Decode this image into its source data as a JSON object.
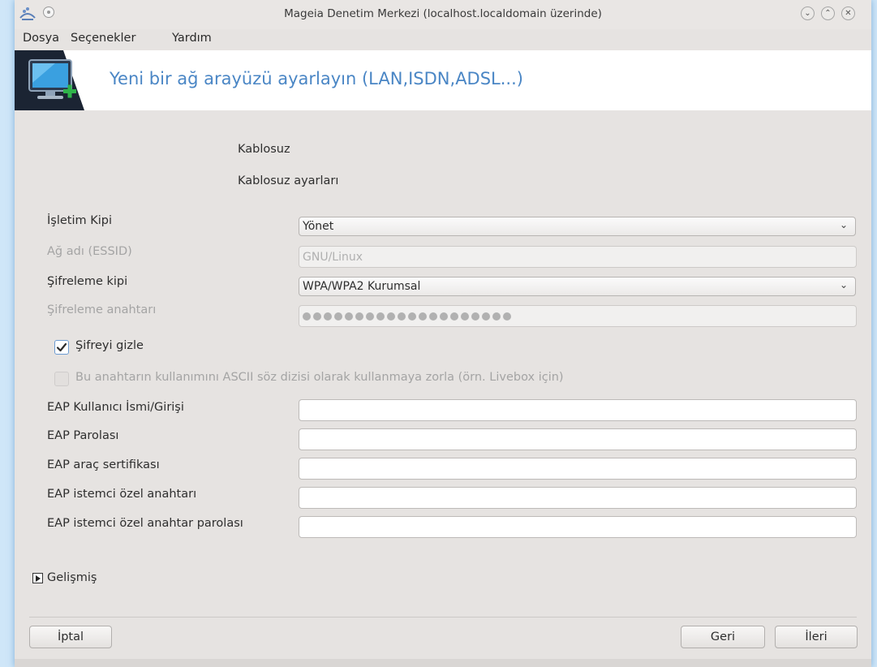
{
  "window": {
    "title": "Mageia Denetim Merkezi  (localhost.localdomain üzerinde)"
  },
  "menubar": {
    "items": [
      "Dosya",
      "Seçenekler",
      "Yardım"
    ]
  },
  "banner": {
    "title": "Yeni bir ağ arayüzü ayarlayın (LAN,ISDN,ADSL...)",
    "icon": "network-monitor-add-icon"
  },
  "sections": {
    "heading1": "Kablosuz",
    "heading2": "Kablosuz ayarları"
  },
  "form": {
    "operation_mode": {
      "label": "İşletim Kipi",
      "value": "Yönet"
    },
    "essid": {
      "label": "Ağ adı (ESSID)",
      "value": "GNU/Linux"
    },
    "encryption_mode": {
      "label": "Şifreleme kipi",
      "value": "WPA/WPA2 Kurumsal"
    },
    "encryption_key": {
      "label": "Şifreleme anahtarı",
      "masked_length": 20
    },
    "hide_password": {
      "label": "Şifreyi gizle",
      "checked": true
    },
    "force_ascii": {
      "label": "Bu anahtarın kullanımını ASCII söz dizisi olarak kullanmaya zorla (örn. Livebox için)",
      "checked": false
    },
    "eap_fields": [
      {
        "label": "EAP Kullanıcı İsmi/Girişi",
        "value": ""
      },
      {
        "label": "EAP Parolası",
        "value": ""
      },
      {
        "label": "EAP araç sertifikası",
        "value": ""
      },
      {
        "label": "EAP istemci özel anahtarı",
        "value": ""
      },
      {
        "label": "EAP istemci özel anahtar parolası",
        "value": ""
      }
    ]
  },
  "advanced": {
    "label": "Gelişmiş"
  },
  "buttons": {
    "cancel": "İptal",
    "back": "Geri",
    "next": "İleri"
  },
  "colors": {
    "accent": "#4a86c5",
    "banner_dark": "#1b2433",
    "window_bg": "#e6e3e1"
  }
}
